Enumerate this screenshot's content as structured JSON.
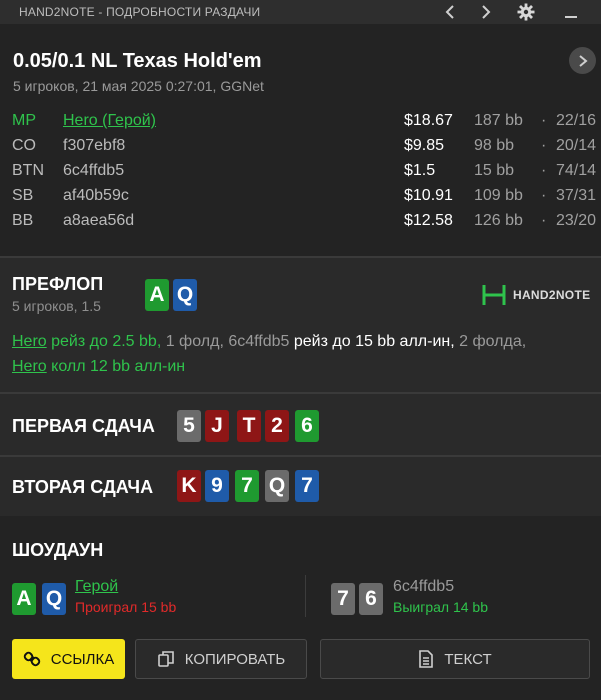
{
  "window": {
    "title": "HAND2NOTE - ПОДРОБНОСТИ РАЗДАЧИ",
    "icons": [
      "chevron-left-icon",
      "chevron-right-icon",
      "gear-icon",
      "minimize-icon"
    ]
  },
  "game": {
    "title": "0.05/0.1 NL Texas Hold'em",
    "subtitle": "5 игроков, 21 мая 2025 0:27:01, GGNet"
  },
  "players": [
    {
      "pos": "MP",
      "name": "Hero (Герой)",
      "stack": "$18.67",
      "bb": "187 bb",
      "dot": "·",
      "stat": "22/16"
    },
    {
      "pos": "CO",
      "name": "f307ebf8",
      "stack": "$9.85",
      "bb": "98 bb",
      "dot": "·",
      "stat": "20/14"
    },
    {
      "pos": "BTN",
      "name": "6c4ffdb5",
      "stack": "$1.5",
      "bb": "15 bb",
      "dot": "·",
      "stat": "74/14"
    },
    {
      "pos": "SB",
      "name": "af40b59c",
      "stack": "$10.91",
      "bb": "109 bb",
      "dot": "·",
      "stat": "37/31"
    },
    {
      "pos": "BB",
      "name": "a8aea56d",
      "stack": "$12.58",
      "bb": "126 bb",
      "dot": "·",
      "stat": "23/20"
    }
  ],
  "preflop": {
    "title": "ПРЕФЛОП",
    "subtitle": "5 игроков, 1.5",
    "cards": [
      {
        "rank": "A",
        "color": "green"
      },
      {
        "rank": "Q",
        "color": "blue"
      }
    ],
    "logo": "HAND2NOTE",
    "line1": {
      "p1": "Hero",
      "a1": " рейз до 2.5 bb,",
      "a2": " 1 фолд, 6c4ffdb5",
      "a3": " рейз до 15 bb алл-ин,",
      "a4": " 2 фолда,"
    },
    "line2": {
      "p1": "Hero",
      "a1": " колл 12 bb алл-ин"
    }
  },
  "board1": {
    "title": "ПЕРВАЯ СДАЧА",
    "cards": [
      {
        "rank": "5",
        "color": "gray"
      },
      {
        "rank": "J",
        "color": "red"
      },
      {
        "rank": "T",
        "color": "red"
      },
      {
        "rank": "2",
        "color": "red"
      },
      {
        "rank": "6",
        "color": "green"
      }
    ]
  },
  "board2": {
    "title": "ВТОРАЯ СДАЧА",
    "cards": [
      {
        "rank": "K",
        "color": "red"
      },
      {
        "rank": "9",
        "color": "blue"
      },
      {
        "rank": "7",
        "color": "green"
      },
      {
        "rank": "Q",
        "color": "gray"
      },
      {
        "rank": "7",
        "color": "blue"
      }
    ]
  },
  "showdown": {
    "title": "ШОУДАУН",
    "left": {
      "cards": [
        {
          "rank": "A",
          "color": "green"
        },
        {
          "rank": "Q",
          "color": "blue"
        }
      ],
      "name": "Герой",
      "result": "Проиграл 15 bb"
    },
    "right": {
      "cards": [
        {
          "rank": "7",
          "color": "gray"
        },
        {
          "rank": "6",
          "color": "gray"
        }
      ],
      "name": "6c4ffdb5",
      "result": "Выиграл 14 bb"
    }
  },
  "buttons": {
    "link": "ССЫЛКА",
    "copy": "КОПИРОВАТЬ",
    "text": "ТЕКСТ"
  },
  "colors": {
    "hero_green": "#2fc34c",
    "loss_red": "#e12a2a",
    "win_green": "#2fc34c",
    "accent_yellow": "#f5e51b",
    "card_green": "#1f9a30",
    "card_blue": "#1f5ba9",
    "card_red": "#8e1616",
    "card_gray": "#6b6b6b"
  }
}
